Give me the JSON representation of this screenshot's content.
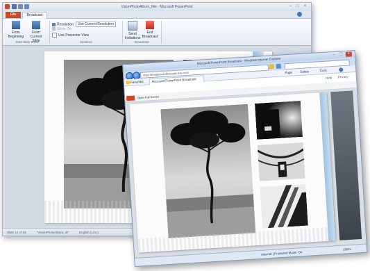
{
  "powerpoint": {
    "title": "VisionPhotoAlbum_File - Microsoft PowerPoint",
    "tabs": {
      "file": "File",
      "broadcast": "Broadcast"
    },
    "ribbon": {
      "from_beginning": "From Beginning",
      "from_current_slide": "From Current Slide",
      "group_start": "Start Slide Show",
      "resolution_label": "Resolution:",
      "resolution_value": "Use Current Resolution",
      "show_on": "Show On:",
      "use_presenter_view": "Use Presenter View",
      "group_monitors": "Monitors",
      "send_invitations": "Send Invitations",
      "end_broadcast": "End Broadcast",
      "group_broadcast": "Broadcast"
    },
    "status": {
      "slide": "Slide 14 of 16",
      "theme": "\"VisionPhotoAlbum_st\"",
      "language": "English (U.S.)"
    }
  },
  "browser": {
    "title": "Microsoft PowerPoint Broadcast - Windows Internet Explorer",
    "address": "https://broadcast.officeapps.live.com/",
    "favorites": "Favorites",
    "tab_label": "Microsoft PowerPoint Broadcast",
    "commands": {
      "page": "Page",
      "safety": "Safety",
      "tools": "Tools"
    },
    "page_links": {
      "help": "Help",
      "privacy": "Privacy"
    },
    "viewer": {
      "open_full": "Open Full Screen"
    },
    "status": {
      "zone": "Internet | Protected Mode: On",
      "zoom": "100%"
    }
  }
}
